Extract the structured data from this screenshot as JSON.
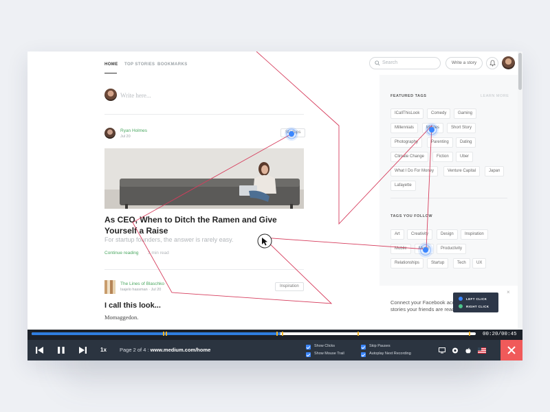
{
  "nav": {
    "tabs": [
      {
        "label": "HOME",
        "active": true
      },
      {
        "label": "TOP STORIES",
        "active": false
      },
      {
        "label": "BOOKMARKS",
        "active": false
      }
    ],
    "search_placeholder": "Search",
    "write_story_label": "Write a story"
  },
  "compose": {
    "placeholder": "Write here..."
  },
  "post1": {
    "author": "Ryan Holmes",
    "date": "Jul 20",
    "tag": "Startups",
    "title": "As CEO, When to Ditch the Ramen and Give Yourself a Raise",
    "subtitle": "For startup founders, the answer is rarely easy.",
    "continue_label": "Continue reading",
    "read_time": "3 min read"
  },
  "post2": {
    "publication": "The Lines of Blaschko",
    "meta": "Isajelo hassman · Jul 20",
    "tag": "Inspiration",
    "title": "I call this look...",
    "subtitle": "Momaggedon."
  },
  "sidebar": {
    "featured_title": "FEATURED TAGS",
    "learn_more": "LEARN MORE",
    "featured_tags": [
      "ICallThisLook",
      "Comedy",
      "Gaming",
      "Millennials",
      "Movies",
      "Short Story",
      "Photography",
      "Parenting",
      "Dating",
      "Climate Change",
      "Fiction",
      "Uber",
      "What I Do For Money",
      "Venture Capital",
      "Japan",
      "Lafayette"
    ],
    "follow_title": "TAGS YOU FOLLOW",
    "follow_tags": [
      "Art",
      "Creativity",
      "Design",
      "Inspiration",
      "Mobile",
      "Music",
      "Productivity",
      "Relationships",
      "Startup",
      "Tech",
      "UX"
    ],
    "facebook_text": "Connect your Facebook account to find more stories your friends are reading and writing.",
    "facebook_close": "×"
  },
  "legend": {
    "left_click": "LEFT CLICK",
    "right_click": "RIGHT CLICK"
  },
  "colors": {
    "accent_green": "#4aa760",
    "path_red": "#d63c5c",
    "left_click": "#3a86ff",
    "right_click": "#4cc38a",
    "close_red": "#f05a5a"
  },
  "player": {
    "progress": 0.56,
    "time": "00:20/00:45",
    "speed": "1x",
    "page_prefix": "Page 2 of 4 : ",
    "page_url": "www.medium.com/home",
    "options": {
      "show_clicks": "Show Clicks",
      "show_mouse_trail": "Show Mouse Trail",
      "skip_pauses": "Skip Pauses",
      "autoplay_next": "Autoplay Next Recording"
    },
    "os_icons": [
      "desktop-icon",
      "chrome-icon",
      "apple-icon",
      "us-flag-icon"
    ]
  }
}
